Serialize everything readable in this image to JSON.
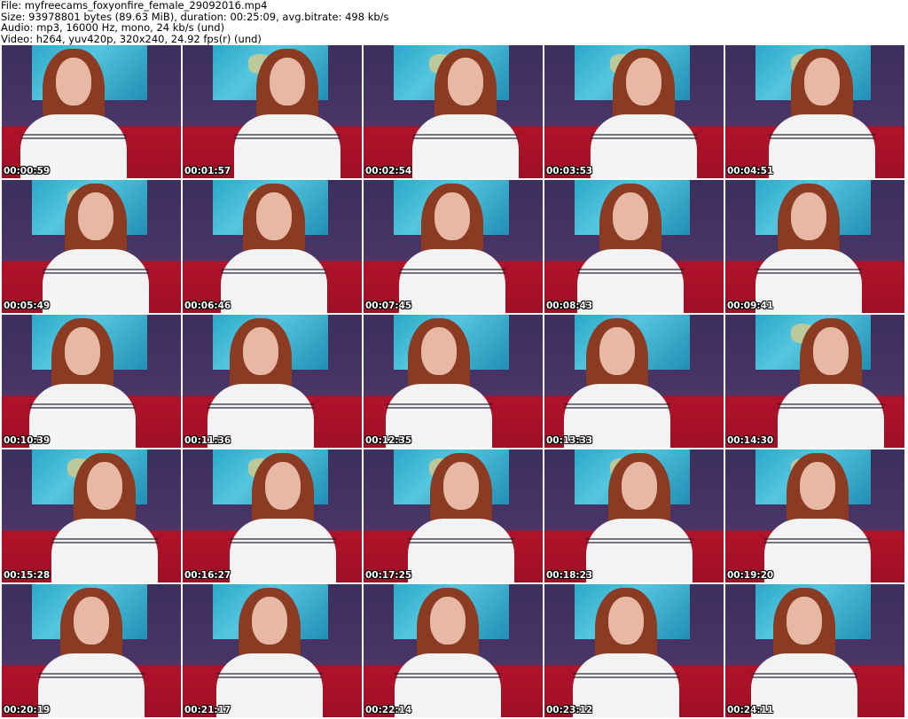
{
  "header": {
    "lines": [
      "File: myfreecams_foxyonfire_female_29092016.mp4",
      "Size: 93978801 bytes (89.63 MiB), duration: 00:25:09, avg.bitrate: 498 kb/s",
      "Audio: mp3, 16000 Hz, mono, 24 kb/s (und)",
      "Video: h264, yuv420p, 320x240, 24.92 fps(r) (und)"
    ]
  },
  "thumbnails": [
    {
      "timestamp": "00:00:59"
    },
    {
      "timestamp": "00:01:57"
    },
    {
      "timestamp": "00:02:54"
    },
    {
      "timestamp": "00:03:53"
    },
    {
      "timestamp": "00:04:51"
    },
    {
      "timestamp": "00:05:49"
    },
    {
      "timestamp": "00:06:46"
    },
    {
      "timestamp": "00:07:45"
    },
    {
      "timestamp": "00:08:43"
    },
    {
      "timestamp": "00:09:41"
    },
    {
      "timestamp": "00:10:39"
    },
    {
      "timestamp": "00:11:36"
    },
    {
      "timestamp": "00:12:35"
    },
    {
      "timestamp": "00:13:33"
    },
    {
      "timestamp": "00:14:30"
    },
    {
      "timestamp": "00:15:28"
    },
    {
      "timestamp": "00:16:27"
    },
    {
      "timestamp": "00:17:25"
    },
    {
      "timestamp": "00:18:23"
    },
    {
      "timestamp": "00:19:20"
    },
    {
      "timestamp": "00:20:19"
    },
    {
      "timestamp": "00:21:17"
    },
    {
      "timestamp": "00:22:14"
    },
    {
      "timestamp": "00:23:12"
    },
    {
      "timestamp": "00:24:11"
    }
  ]
}
